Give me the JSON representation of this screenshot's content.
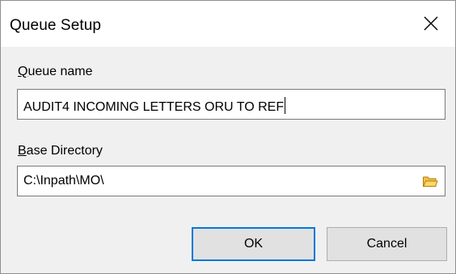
{
  "dialog": {
    "title": "Queue Setup"
  },
  "queue_name": {
    "label_accel": "Q",
    "label_rest": "ueue name",
    "value": "AUDIT4 INCOMING LETTERS ORU TO REF"
  },
  "base_directory": {
    "label_accel": "B",
    "label_rest": "ase Directory",
    "value": "C:\\Inpath\\MO\\"
  },
  "buttons": {
    "ok_label": "OK",
    "cancel_label": "Cancel"
  },
  "icons": {
    "close": "close-icon",
    "folder": "folder-icon"
  },
  "colors": {
    "default_button_border": "#0078d7",
    "client_background": "#f0f0f0",
    "folder_icon_fill": "#f5c043"
  }
}
